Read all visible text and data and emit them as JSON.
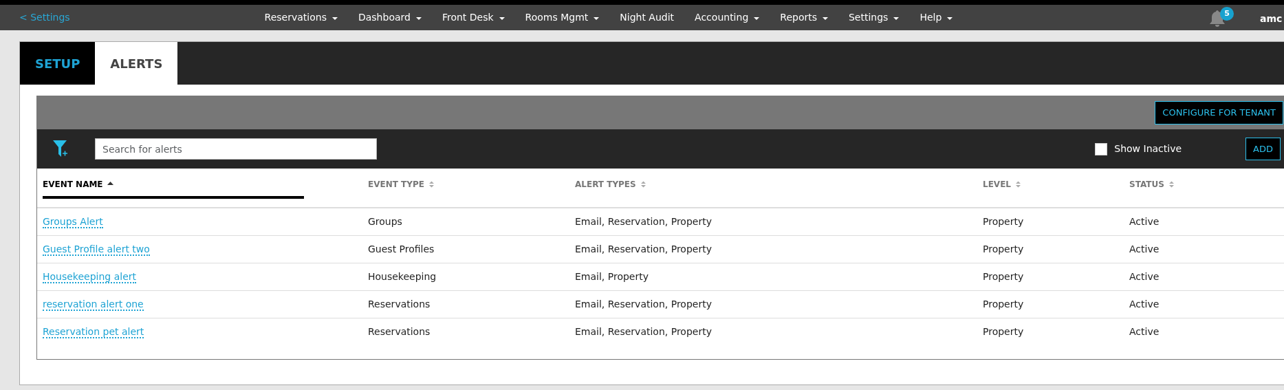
{
  "topbar": {
    "back_link": "< Settings",
    "menu": [
      {
        "label": "Reservations",
        "dropdown": true
      },
      {
        "label": "Dashboard",
        "dropdown": true
      },
      {
        "label": "Front Desk",
        "dropdown": true
      },
      {
        "label": "Rooms Mgmt",
        "dropdown": true
      },
      {
        "label": "Night Audit",
        "dropdown": false
      },
      {
        "label": "Accounting",
        "dropdown": true
      },
      {
        "label": "Reports",
        "dropdown": true
      },
      {
        "label": "Settings",
        "dropdown": true
      },
      {
        "label": "Help",
        "dropdown": true
      }
    ],
    "notification_count": "5",
    "user": "amc"
  },
  "tabs": [
    {
      "label": "SETUP",
      "selected": false
    },
    {
      "label": "ALERTS",
      "selected": true
    }
  ],
  "configure_button": "CONFIGURE FOR TENANT",
  "search": {
    "placeholder": "Search for alerts"
  },
  "show_inactive": {
    "label": "Show Inactive",
    "checked": false
  },
  "add_button": "ADD",
  "table": {
    "columns": [
      {
        "label": "EVENT NAME",
        "sorted": true
      },
      {
        "label": "EVENT TYPE",
        "sorted": false
      },
      {
        "label": "ALERT TYPES",
        "sorted": false
      },
      {
        "label": "LEVEL",
        "sorted": false
      },
      {
        "label": "STATUS",
        "sorted": false
      }
    ],
    "rows": [
      [
        "Groups Alert",
        "Groups",
        "Email, Reservation, Property",
        "Property",
        "Active"
      ],
      [
        "Guest Profile alert two",
        "Guest Profiles",
        "Email, Reservation, Property",
        "Property",
        "Active"
      ],
      [
        "Housekeeping alert",
        "Housekeeping",
        "Email, Property",
        "Property",
        "Active"
      ],
      [
        "reservation alert one",
        "Reservations",
        "Email, Reservation, Property",
        "Property",
        "Active"
      ],
      [
        "Reservation pet alert",
        "Reservations",
        "Email, Reservation, Property",
        "Property",
        "Active"
      ]
    ]
  }
}
